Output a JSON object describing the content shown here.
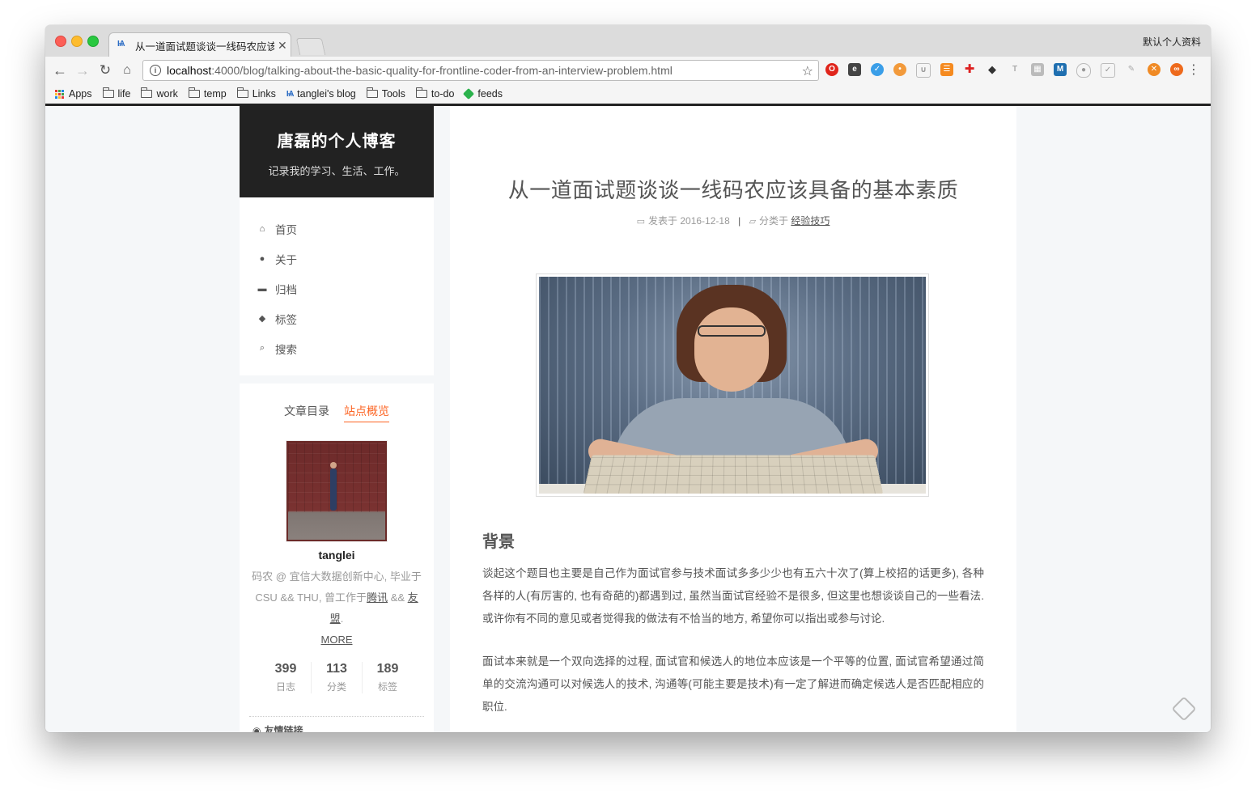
{
  "browser": {
    "tab_title": "从一道面试题谈谈一线码农应该具备的基本素质",
    "tab_favicon": "tanglei-favicon",
    "profile_name": "默认个人资料",
    "url_host": "localhost",
    "url_path": ":4000/blog/talking-about-the-basic-quality-for-frontline-coder-from-an-interview-problem.html",
    "bookmarks": [
      {
        "label": "Apps",
        "icon": "apps-grid-icon"
      },
      {
        "label": "life",
        "icon": "folder-icon"
      },
      {
        "label": "work",
        "icon": "folder-icon"
      },
      {
        "label": "temp",
        "icon": "folder-icon"
      },
      {
        "label": "Links",
        "icon": "folder-icon"
      },
      {
        "label": "tanglei's blog",
        "icon": "tanglei-favicon"
      },
      {
        "label": "Tools",
        "icon": "folder-icon"
      },
      {
        "label": "to-do",
        "icon": "folder-icon"
      },
      {
        "label": "feeds",
        "icon": "feedly-icon"
      }
    ]
  },
  "site": {
    "title": "唐磊的个人博客",
    "subtitle": "记录我的学习、生活、工作。"
  },
  "menu": [
    {
      "label": "首页",
      "icon": "home-icon"
    },
    {
      "label": "关于",
      "icon": "user-icon"
    },
    {
      "label": "归档",
      "icon": "archive-icon"
    },
    {
      "label": "标签",
      "icon": "tags-icon"
    },
    {
      "label": "搜索",
      "icon": "search-icon"
    }
  ],
  "sidebar": {
    "tabs": {
      "toc": "文章目录",
      "overview": "站点概览"
    },
    "author": "tanglei",
    "desc_prefix": "码农 @ 宜信大数据创新中心, 毕业于 CSU && THU, 曾工作于",
    "desc_link1": "腾讯",
    "desc_and": " && ",
    "desc_link2": "友盟",
    "desc_end": ".",
    "more": "MORE",
    "stats": [
      {
        "num": "399",
        "label": "日志"
      },
      {
        "num": "113",
        "label": "分类"
      },
      {
        "num": "189",
        "label": "标签"
      }
    ],
    "links_title": "友情链接"
  },
  "post": {
    "title": "从一道面试题谈谈一线码农应该具备的基本素质",
    "posted_label": "发表于",
    "date": "2016-12-18",
    "category_label": "分类于",
    "category": "经验技巧",
    "section_heading": "背景",
    "para1": "谈起这个题目也主要是自己作为面试官参与技术面试多多少少也有五六十次了(算上校招的话更多), 各种各样的人(有厉害的, 也有奇葩的)都遇到过, 虽然当面试官经验不是很多, 但这里也想谈谈自己的一些看法. 或许你有不同的意见或者觉得我的做法有不恰当的地方, 希望你可以指出或参与讨论.",
    "para2": "面试本来就是一个双向选择的过程, 面试官和候选人的地位本应该是一个平等的位置, 面试官希望通过简单的交流沟通可以对候选人的技术, 沟通等(可能主要是技术)有一定了解进而确定候选人是否匹配相应的职位."
  },
  "colors": {
    "accent": "#fc6423",
    "brand_bg": "#222222",
    "text": "#555555"
  }
}
